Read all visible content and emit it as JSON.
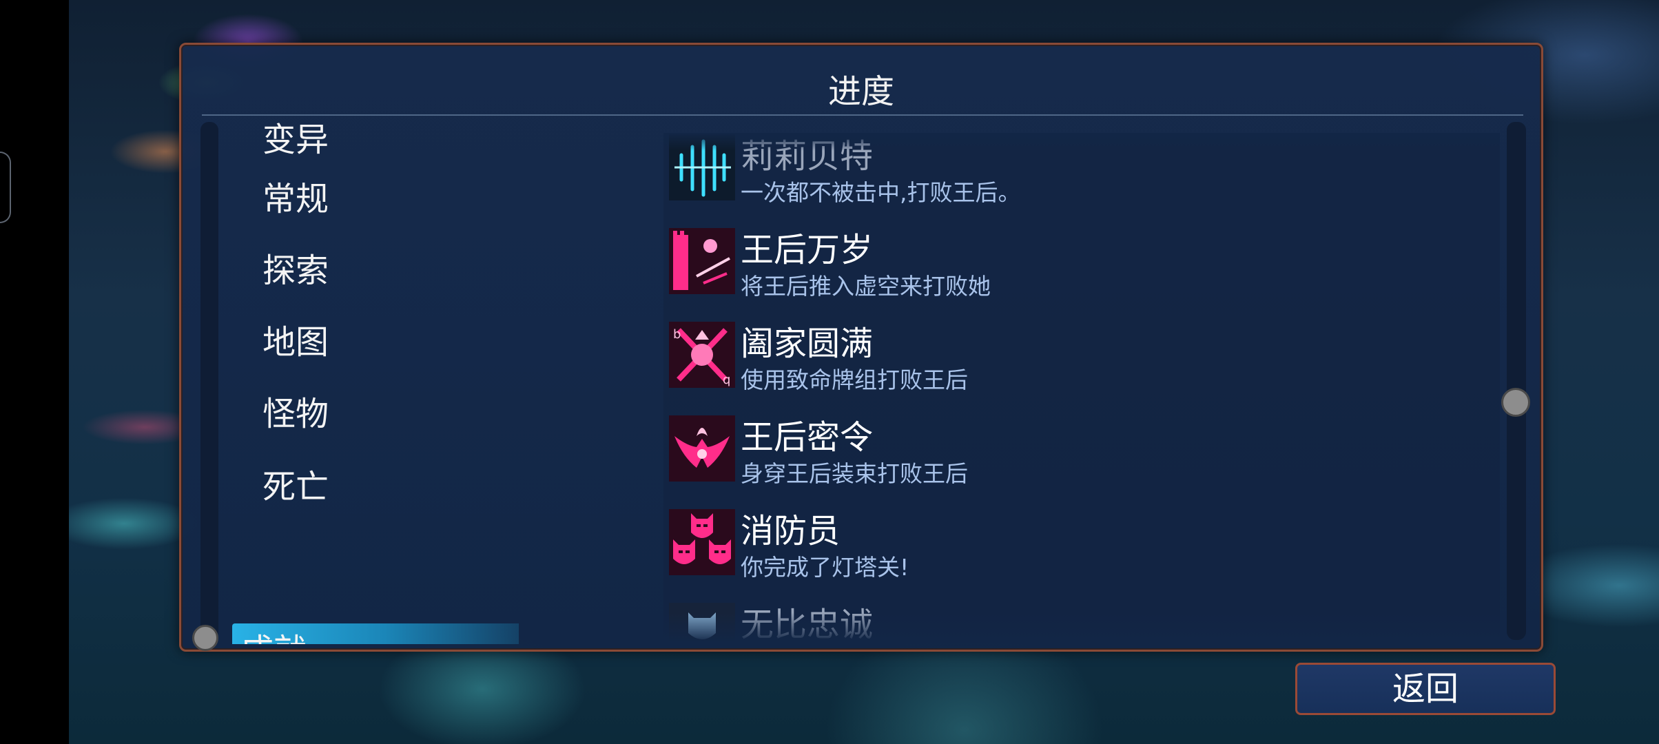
{
  "panel": {
    "title": "进度"
  },
  "categories": [
    {
      "label": "变异",
      "selected": false
    },
    {
      "label": "常规",
      "selected": false
    },
    {
      "label": "探索",
      "selected": false
    },
    {
      "label": "地图",
      "selected": false
    },
    {
      "label": "怪物",
      "selected": false
    },
    {
      "label": "死亡",
      "selected": false
    },
    {
      "label": "成就",
      "selected": true
    }
  ],
  "achievements": [
    {
      "name": "莉莉贝特",
      "desc": "一次都不被击中,打败王后。",
      "icon": "cyan-blades-icon"
    },
    {
      "name": "王后万岁",
      "desc": "将王后推入虚空来打败她",
      "icon": "queen-push-icon"
    },
    {
      "name": "阖家圆满",
      "desc": "使用致命牌组打败王后",
      "icon": "card-deck-icon"
    },
    {
      "name": "王后密令",
      "desc": "身穿王后装束打败王后",
      "icon": "queen-crest-icon"
    },
    {
      "name": "消防员",
      "desc": "你完成了灯塔关!",
      "icon": "three-masks-icon"
    },
    {
      "name": "无比忠诚",
      "desc": "",
      "icon": "mask-icon"
    }
  ],
  "buttons": {
    "back": "返回"
  },
  "colors": {
    "accent": "#29b2e6",
    "icon_magenta": "#ff2d8a",
    "frame": "#8a4a36"
  }
}
